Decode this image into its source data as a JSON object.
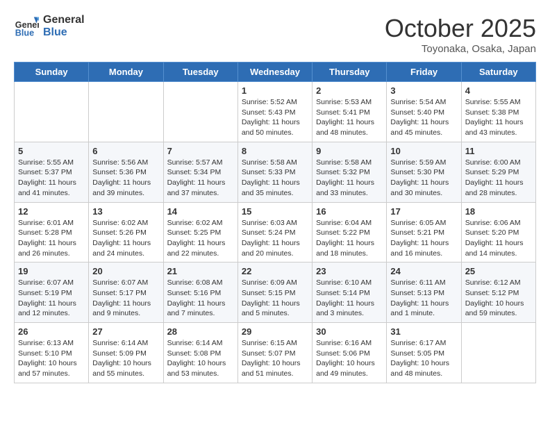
{
  "header": {
    "logo_line1": "General",
    "logo_line2": "Blue",
    "month": "October 2025",
    "location": "Toyonaka, Osaka, Japan"
  },
  "weekdays": [
    "Sunday",
    "Monday",
    "Tuesday",
    "Wednesday",
    "Thursday",
    "Friday",
    "Saturday"
  ],
  "weeks": [
    [
      {
        "day": "",
        "info": ""
      },
      {
        "day": "",
        "info": ""
      },
      {
        "day": "",
        "info": ""
      },
      {
        "day": "1",
        "info": "Sunrise: 5:52 AM\nSunset: 5:43 PM\nDaylight: 11 hours\nand 50 minutes."
      },
      {
        "day": "2",
        "info": "Sunrise: 5:53 AM\nSunset: 5:41 PM\nDaylight: 11 hours\nand 48 minutes."
      },
      {
        "day": "3",
        "info": "Sunrise: 5:54 AM\nSunset: 5:40 PM\nDaylight: 11 hours\nand 45 minutes."
      },
      {
        "day": "4",
        "info": "Sunrise: 5:55 AM\nSunset: 5:38 PM\nDaylight: 11 hours\nand 43 minutes."
      }
    ],
    [
      {
        "day": "5",
        "info": "Sunrise: 5:55 AM\nSunset: 5:37 PM\nDaylight: 11 hours\nand 41 minutes."
      },
      {
        "day": "6",
        "info": "Sunrise: 5:56 AM\nSunset: 5:36 PM\nDaylight: 11 hours\nand 39 minutes."
      },
      {
        "day": "7",
        "info": "Sunrise: 5:57 AM\nSunset: 5:34 PM\nDaylight: 11 hours\nand 37 minutes."
      },
      {
        "day": "8",
        "info": "Sunrise: 5:58 AM\nSunset: 5:33 PM\nDaylight: 11 hours\nand 35 minutes."
      },
      {
        "day": "9",
        "info": "Sunrise: 5:58 AM\nSunset: 5:32 PM\nDaylight: 11 hours\nand 33 minutes."
      },
      {
        "day": "10",
        "info": "Sunrise: 5:59 AM\nSunset: 5:30 PM\nDaylight: 11 hours\nand 30 minutes."
      },
      {
        "day": "11",
        "info": "Sunrise: 6:00 AM\nSunset: 5:29 PM\nDaylight: 11 hours\nand 28 minutes."
      }
    ],
    [
      {
        "day": "12",
        "info": "Sunrise: 6:01 AM\nSunset: 5:28 PM\nDaylight: 11 hours\nand 26 minutes."
      },
      {
        "day": "13",
        "info": "Sunrise: 6:02 AM\nSunset: 5:26 PM\nDaylight: 11 hours\nand 24 minutes."
      },
      {
        "day": "14",
        "info": "Sunrise: 6:02 AM\nSunset: 5:25 PM\nDaylight: 11 hours\nand 22 minutes."
      },
      {
        "day": "15",
        "info": "Sunrise: 6:03 AM\nSunset: 5:24 PM\nDaylight: 11 hours\nand 20 minutes."
      },
      {
        "day": "16",
        "info": "Sunrise: 6:04 AM\nSunset: 5:22 PM\nDaylight: 11 hours\nand 18 minutes."
      },
      {
        "day": "17",
        "info": "Sunrise: 6:05 AM\nSunset: 5:21 PM\nDaylight: 11 hours\nand 16 minutes."
      },
      {
        "day": "18",
        "info": "Sunrise: 6:06 AM\nSunset: 5:20 PM\nDaylight: 11 hours\nand 14 minutes."
      }
    ],
    [
      {
        "day": "19",
        "info": "Sunrise: 6:07 AM\nSunset: 5:19 PM\nDaylight: 11 hours\nand 12 minutes."
      },
      {
        "day": "20",
        "info": "Sunrise: 6:07 AM\nSunset: 5:17 PM\nDaylight: 11 hours\nand 9 minutes."
      },
      {
        "day": "21",
        "info": "Sunrise: 6:08 AM\nSunset: 5:16 PM\nDaylight: 11 hours\nand 7 minutes."
      },
      {
        "day": "22",
        "info": "Sunrise: 6:09 AM\nSunset: 5:15 PM\nDaylight: 11 hours\nand 5 minutes."
      },
      {
        "day": "23",
        "info": "Sunrise: 6:10 AM\nSunset: 5:14 PM\nDaylight: 11 hours\nand 3 minutes."
      },
      {
        "day": "24",
        "info": "Sunrise: 6:11 AM\nSunset: 5:13 PM\nDaylight: 11 hours\nand 1 minute."
      },
      {
        "day": "25",
        "info": "Sunrise: 6:12 AM\nSunset: 5:12 PM\nDaylight: 10 hours\nand 59 minutes."
      }
    ],
    [
      {
        "day": "26",
        "info": "Sunrise: 6:13 AM\nSunset: 5:10 PM\nDaylight: 10 hours\nand 57 minutes."
      },
      {
        "day": "27",
        "info": "Sunrise: 6:14 AM\nSunset: 5:09 PM\nDaylight: 10 hours\nand 55 minutes."
      },
      {
        "day": "28",
        "info": "Sunrise: 6:14 AM\nSunset: 5:08 PM\nDaylight: 10 hours\nand 53 minutes."
      },
      {
        "day": "29",
        "info": "Sunrise: 6:15 AM\nSunset: 5:07 PM\nDaylight: 10 hours\nand 51 minutes."
      },
      {
        "day": "30",
        "info": "Sunrise: 6:16 AM\nSunset: 5:06 PM\nDaylight: 10 hours\nand 49 minutes."
      },
      {
        "day": "31",
        "info": "Sunrise: 6:17 AM\nSunset: 5:05 PM\nDaylight: 10 hours\nand 48 minutes."
      },
      {
        "day": "",
        "info": ""
      }
    ]
  ]
}
